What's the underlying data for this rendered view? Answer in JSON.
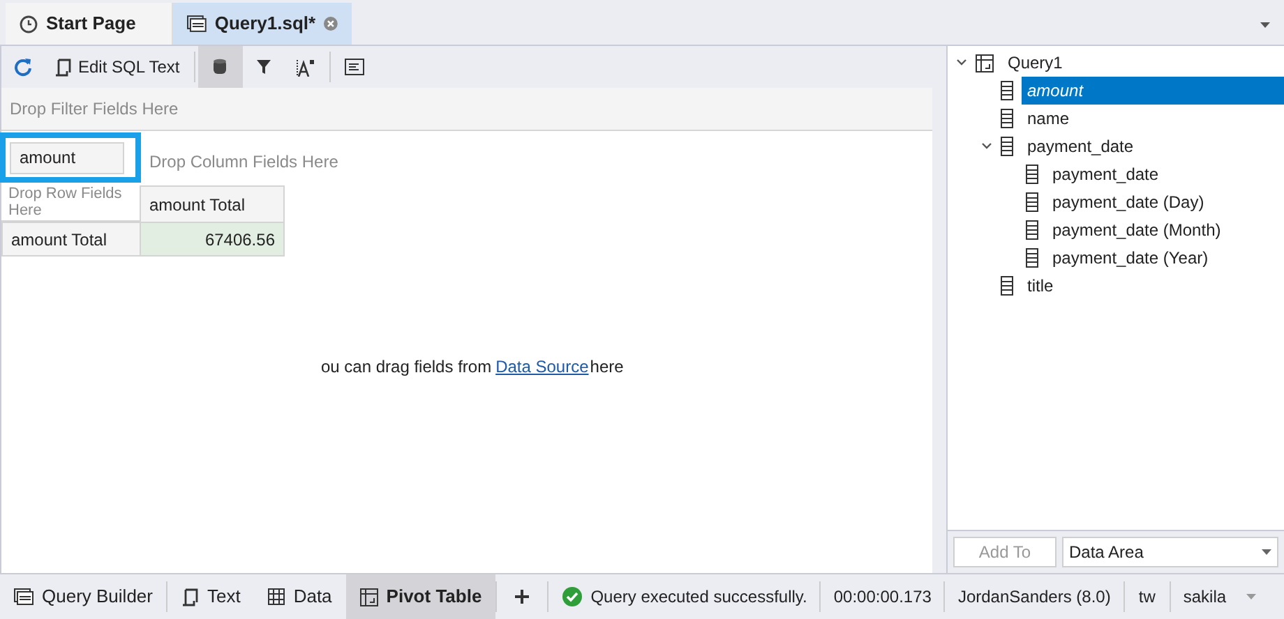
{
  "doc_tabs": [
    {
      "label": "Start Page",
      "kind": "start",
      "selected": false,
      "closable": false
    },
    {
      "label": "Query1.sql*",
      "kind": "query",
      "selected": true,
      "closable": true
    }
  ],
  "toolbar": {
    "edit_sql": "Edit SQL Text",
    "data_source_selected": true
  },
  "pivot": {
    "filter_hint": "Drop Filter Fields Here",
    "data_field": "amount",
    "column_hint": "Drop Column Fields Here",
    "row_hint": "Drop Row Fields Here",
    "column_header": "amount Total",
    "row_header": "amount Total",
    "value": "67406.56",
    "empty_hint": {
      "before": "ou can drag fields from",
      "link": "Data Source",
      "after": "here"
    }
  },
  "field_tree": [
    {
      "label": "Query1",
      "kind": "root",
      "expanded": true,
      "selected": false,
      "children": [
        {
          "label": "amount",
          "kind": "field",
          "selected": true
        },
        {
          "label": "name",
          "kind": "field",
          "selected": false
        },
        {
          "label": "payment_date",
          "kind": "field",
          "selected": false,
          "expanded": true,
          "children": [
            {
              "label": "payment_date",
              "kind": "field",
              "selected": false
            },
            {
              "label": "payment_date (Day)",
              "kind": "field",
              "selected": false
            },
            {
              "label": "payment_date (Month)",
              "kind": "field",
              "selected": false
            },
            {
              "label": "payment_date (Year)",
              "kind": "field",
              "selected": false
            }
          ]
        },
        {
          "label": "title",
          "kind": "field",
          "selected": false
        }
      ]
    }
  ],
  "add_to": {
    "button": "Add To",
    "area": "Data Area"
  },
  "view_tabs": [
    {
      "label": "Query Builder",
      "kind": "builder",
      "selected": false
    },
    {
      "label": "Text",
      "kind": "text",
      "selected": false
    },
    {
      "label": "Data",
      "kind": "data",
      "selected": false
    },
    {
      "label": "Pivot Table",
      "kind": "pivot",
      "selected": true
    }
  ],
  "status_bar": {
    "message": "Query executed successfully.",
    "time": "00:00:00.173",
    "connection": "JordanSanders (8.0)",
    "schema_short": "tw",
    "database": "sakila"
  }
}
